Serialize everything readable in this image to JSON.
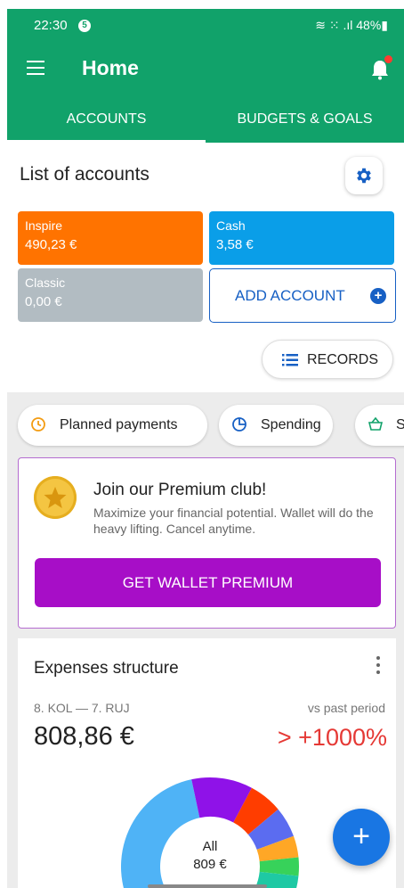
{
  "status_bar": {
    "time": "22:30",
    "notification_count": "5",
    "right": "≋ ⁙ .ıl 48%▮"
  },
  "app_bar": {
    "title": "Home",
    "menu_icon": "hamburger-icon",
    "bell_icon": "bell-icon"
  },
  "tabs": [
    {
      "label": "ACCOUNTS",
      "active": true
    },
    {
      "label": "BUDGETS & GOALS",
      "active": false
    }
  ],
  "accounts_section": {
    "heading": "List of accounts",
    "settings_icon": "gear-icon",
    "accounts": [
      {
        "name": "Inspire",
        "amount": "490,23 €",
        "color": "#ff7300"
      },
      {
        "name": "Cash",
        "amount": "3,58 €",
        "color": "#0a9ee8"
      },
      {
        "name": "Classic",
        "amount": "0,00 €",
        "color": "#b2bcc2"
      }
    ],
    "add_account_label": "ADD ACCOUNT",
    "records_label": "RECORDS"
  },
  "chips": [
    {
      "label": "Planned payments",
      "icon": "clock-icon"
    },
    {
      "label": "Spending",
      "icon": "pie-chart-icon"
    },
    {
      "label": "S",
      "icon": "basket-icon"
    }
  ],
  "premium": {
    "title": "Join our Premium club!",
    "description": "Maximize your financial potential. Wallet will do the heavy lifting. Cancel anytime.",
    "button_label": "GET WALLET PREMIUM",
    "accent": "#a70ec7"
  },
  "expenses": {
    "title": "Expenses structure",
    "period": "8. KOL — 7. RUJ",
    "vs_label": "vs past period",
    "total": "808,86 €",
    "change": "> +1000%",
    "center_label": "All",
    "center_value": "809 €",
    "segment_colors": [
      "#4fb3f6",
      "#8f12e8",
      "#ff3d00",
      "#5b6cf0",
      "#ffa726",
      "#37d25a",
      "#1ec9a4"
    ]
  },
  "fab_label": "+",
  "colors": {
    "primary": "#11a26a",
    "link": "#1760c4",
    "negative": "#e53935"
  }
}
